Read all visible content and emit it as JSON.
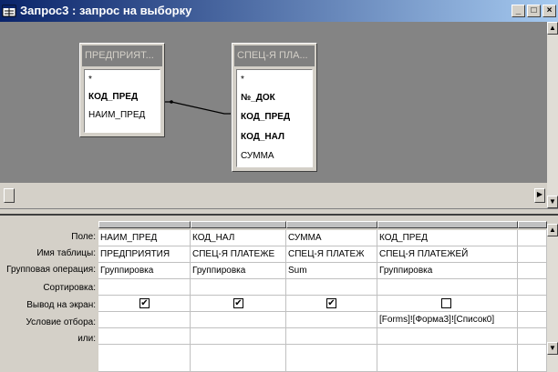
{
  "window": {
    "title": "Запрос3 : запрос на выборку",
    "minimize_glyph": "_",
    "maximize_glyph": "□",
    "close_glyph": "×"
  },
  "tables": [
    {
      "title": "ПРЕДПРИЯТ...",
      "fields": [
        {
          "name": "*",
          "bold": false
        },
        {
          "name": "КОД_ПРЕД",
          "bold": true
        },
        {
          "name": "НАИМ_ПРЕД",
          "bold": false
        }
      ]
    },
    {
      "title": "СПЕЦ-Я ПЛА...",
      "fields": [
        {
          "name": "*",
          "bold": false
        },
        {
          "name": "№_ДОК",
          "bold": true
        },
        {
          "name": "КОД_ПРЕД",
          "bold": true
        },
        {
          "name": "КОД_НАЛ",
          "bold": true
        },
        {
          "name": "СУММА",
          "bold": false
        }
      ]
    }
  ],
  "grid": {
    "row_labels": [
      "Поле:",
      "Имя таблицы:",
      "Групповая операция:",
      "Сортировка:",
      "Вывод на экран:",
      "Условие отбора:",
      "или:"
    ],
    "columns": [
      {
        "field": "НАИМ_ПРЕД",
        "table": "ПРЕДПРИЯТИЯ",
        "group": "Группировка",
        "sort": "",
        "show": true,
        "criteria": "",
        "or": ""
      },
      {
        "field": "КОД_НАЛ",
        "table": "СПЕЦ-Я ПЛАТЕЖЕ",
        "group": "Группировка",
        "sort": "",
        "show": true,
        "criteria": "",
        "or": ""
      },
      {
        "field": "СУММА",
        "table": "СПЕЦ-Я ПЛАТЕЖ",
        "group": "Sum",
        "sort": "",
        "show": true,
        "criteria": "",
        "or": ""
      },
      {
        "field": "КОД_ПРЕД",
        "table": "СПЕЦ-Я ПЛАТЕЖЕЙ",
        "group": "Группировка",
        "sort": "",
        "show": false,
        "criteria": "[Forms]![Форма3]![Список0]",
        "or": ""
      },
      {
        "field": "",
        "table": "",
        "group": "",
        "sort": "",
        "show": null,
        "criteria": "",
        "or": ""
      }
    ]
  },
  "checkbox_checked_glyph": "✔"
}
